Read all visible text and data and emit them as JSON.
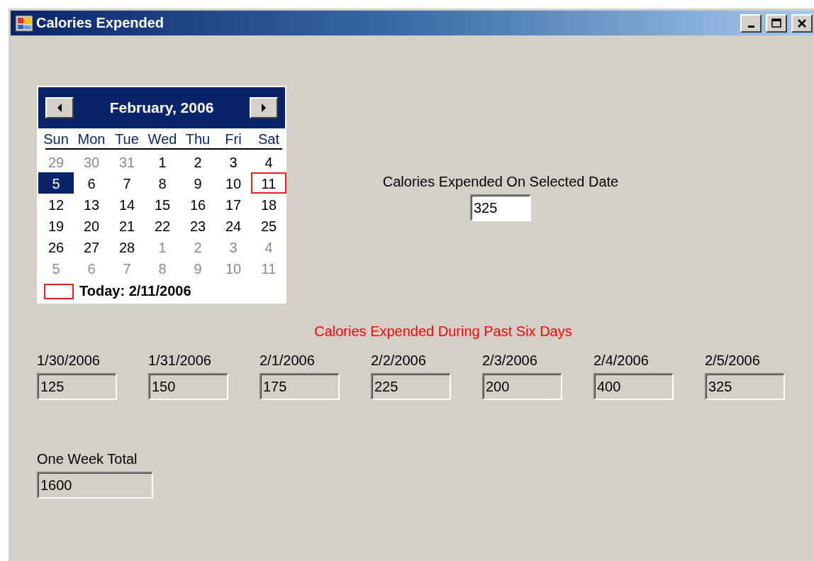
{
  "window": {
    "title": "Calories Expended"
  },
  "calendar": {
    "month_label": "February, 2006",
    "weekdays": [
      "Sun",
      "Mon",
      "Tue",
      "Wed",
      "Thu",
      "Fri",
      "Sat"
    ],
    "weeks": [
      [
        {
          "day": "29",
          "other_month": true,
          "selected": false,
          "today": false
        },
        {
          "day": "30",
          "other_month": true,
          "selected": false,
          "today": false
        },
        {
          "day": "31",
          "other_month": true,
          "selected": false,
          "today": false
        },
        {
          "day": "1",
          "other_month": false,
          "selected": false,
          "today": false
        },
        {
          "day": "2",
          "other_month": false,
          "selected": false,
          "today": false
        },
        {
          "day": "3",
          "other_month": false,
          "selected": false,
          "today": false
        },
        {
          "day": "4",
          "other_month": false,
          "selected": false,
          "today": false
        }
      ],
      [
        {
          "day": "5",
          "other_month": false,
          "selected": true,
          "today": false
        },
        {
          "day": "6",
          "other_month": false,
          "selected": false,
          "today": false
        },
        {
          "day": "7",
          "other_month": false,
          "selected": false,
          "today": false
        },
        {
          "day": "8",
          "other_month": false,
          "selected": false,
          "today": false
        },
        {
          "day": "9",
          "other_month": false,
          "selected": false,
          "today": false
        },
        {
          "day": "10",
          "other_month": false,
          "selected": false,
          "today": false
        },
        {
          "day": "11",
          "other_month": false,
          "selected": false,
          "today": true
        }
      ],
      [
        {
          "day": "12",
          "other_month": false,
          "selected": false,
          "today": false
        },
        {
          "day": "13",
          "other_month": false,
          "selected": false,
          "today": false
        },
        {
          "day": "14",
          "other_month": false,
          "selected": false,
          "today": false
        },
        {
          "day": "15",
          "other_month": false,
          "selected": false,
          "today": false
        },
        {
          "day": "16",
          "other_month": false,
          "selected": false,
          "today": false
        },
        {
          "day": "17",
          "other_month": false,
          "selected": false,
          "today": false
        },
        {
          "day": "18",
          "other_month": false,
          "selected": false,
          "today": false
        }
      ],
      [
        {
          "day": "19",
          "other_month": false,
          "selected": false,
          "today": false
        },
        {
          "day": "20",
          "other_month": false,
          "selected": false,
          "today": false
        },
        {
          "day": "21",
          "other_month": false,
          "selected": false,
          "today": false
        },
        {
          "day": "22",
          "other_month": false,
          "selected": false,
          "today": false
        },
        {
          "day": "23",
          "other_month": false,
          "selected": false,
          "today": false
        },
        {
          "day": "24",
          "other_month": false,
          "selected": false,
          "today": false
        },
        {
          "day": "25",
          "other_month": false,
          "selected": false,
          "today": false
        }
      ],
      [
        {
          "day": "26",
          "other_month": false,
          "selected": false,
          "today": false
        },
        {
          "day": "27",
          "other_month": false,
          "selected": false,
          "today": false
        },
        {
          "day": "28",
          "other_month": false,
          "selected": false,
          "today": false
        },
        {
          "day": "1",
          "other_month": true,
          "selected": false,
          "today": false
        },
        {
          "day": "2",
          "other_month": true,
          "selected": false,
          "today": false
        },
        {
          "day": "3",
          "other_month": true,
          "selected": false,
          "today": false
        },
        {
          "day": "4",
          "other_month": true,
          "selected": false,
          "today": false
        }
      ],
      [
        {
          "day": "5",
          "other_month": true,
          "selected": false,
          "today": false
        },
        {
          "day": "6",
          "other_month": true,
          "selected": false,
          "today": false
        },
        {
          "day": "7",
          "other_month": true,
          "selected": false,
          "today": false
        },
        {
          "day": "8",
          "other_month": true,
          "selected": false,
          "today": false
        },
        {
          "day": "9",
          "other_month": true,
          "selected": false,
          "today": false
        },
        {
          "day": "10",
          "other_month": true,
          "selected": false,
          "today": false
        },
        {
          "day": "11",
          "other_month": true,
          "selected": false,
          "today": false
        }
      ]
    ],
    "today_label": "Today: 2/11/2006"
  },
  "selected_date": {
    "label": "Calories Expended On Selected Date",
    "value": "325",
    "read_only": false
  },
  "past_days": {
    "heading": "Calories Expended During Past Six Days",
    "days": [
      {
        "date": "1/30/2006",
        "value": "125",
        "read_only": true
      },
      {
        "date": "1/31/2006",
        "value": "150",
        "read_only": true
      },
      {
        "date": "2/1/2006",
        "value": "175",
        "read_only": true
      },
      {
        "date": "2/2/2006",
        "value": "225",
        "read_only": true
      },
      {
        "date": "2/3/2006",
        "value": "200",
        "read_only": true
      },
      {
        "date": "2/4/2006",
        "value": "400",
        "read_only": true
      },
      {
        "date": "2/5/2006",
        "value": "325",
        "read_only": true
      }
    ]
  },
  "week_total": {
    "label": "One Week Total",
    "value": "1600",
    "read_only": true
  }
}
